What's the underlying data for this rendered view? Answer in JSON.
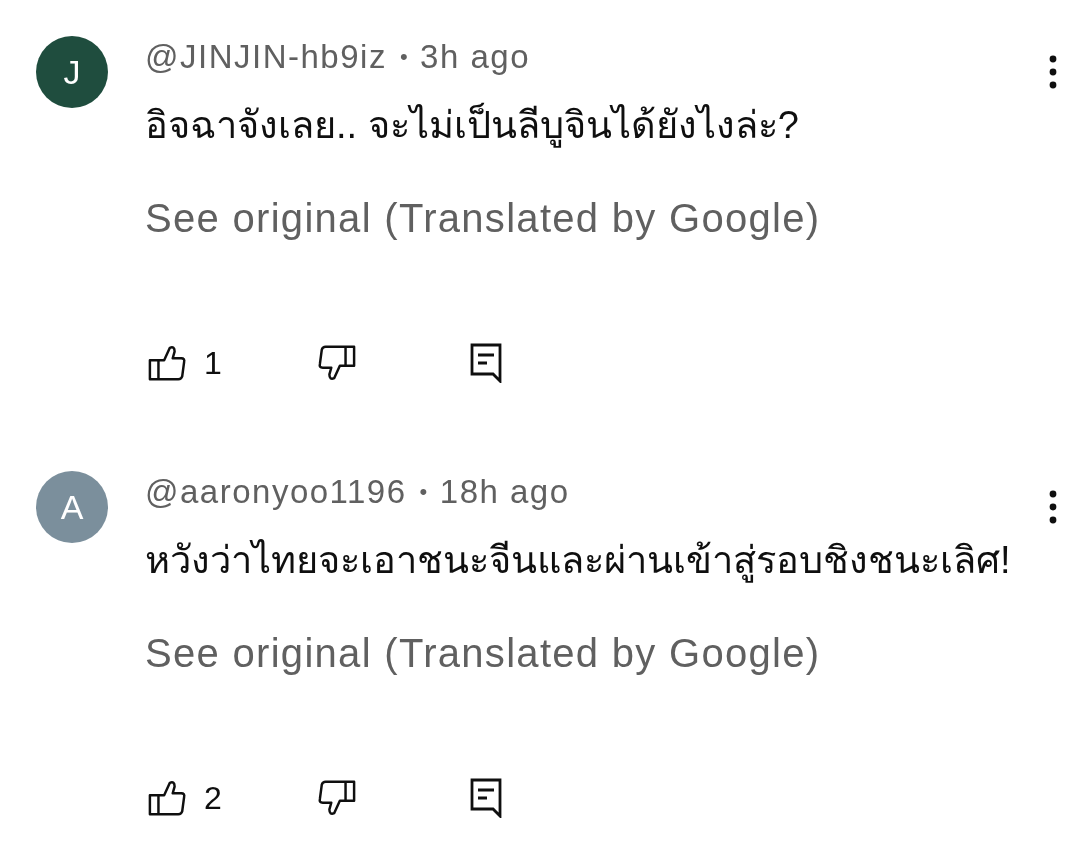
{
  "comments": [
    {
      "avatar_letter": "J",
      "color": "#1f4d3e",
      "author": "@JINJIN-hb9iz",
      "separator": "•",
      "time": "3h ago",
      "text": "อิจฉาจังเลย.. จะไม่เป็นลีบูจินได้ยังไงล่ะ?",
      "translate_link": "See original (Translated by Google)",
      "likes": "1"
    },
    {
      "avatar_letter": "A",
      "color": "#7b8f9c",
      "author": "@aaronyoo1196",
      "separator": "•",
      "time": "18h ago",
      "text": "หวังว่าไทยจะเอาชนะจีนและผ่านเข้าสู่รอบชิงชนะเลิศ!",
      "translate_link": "See original (Translated by Google)",
      "likes": "2"
    }
  ]
}
